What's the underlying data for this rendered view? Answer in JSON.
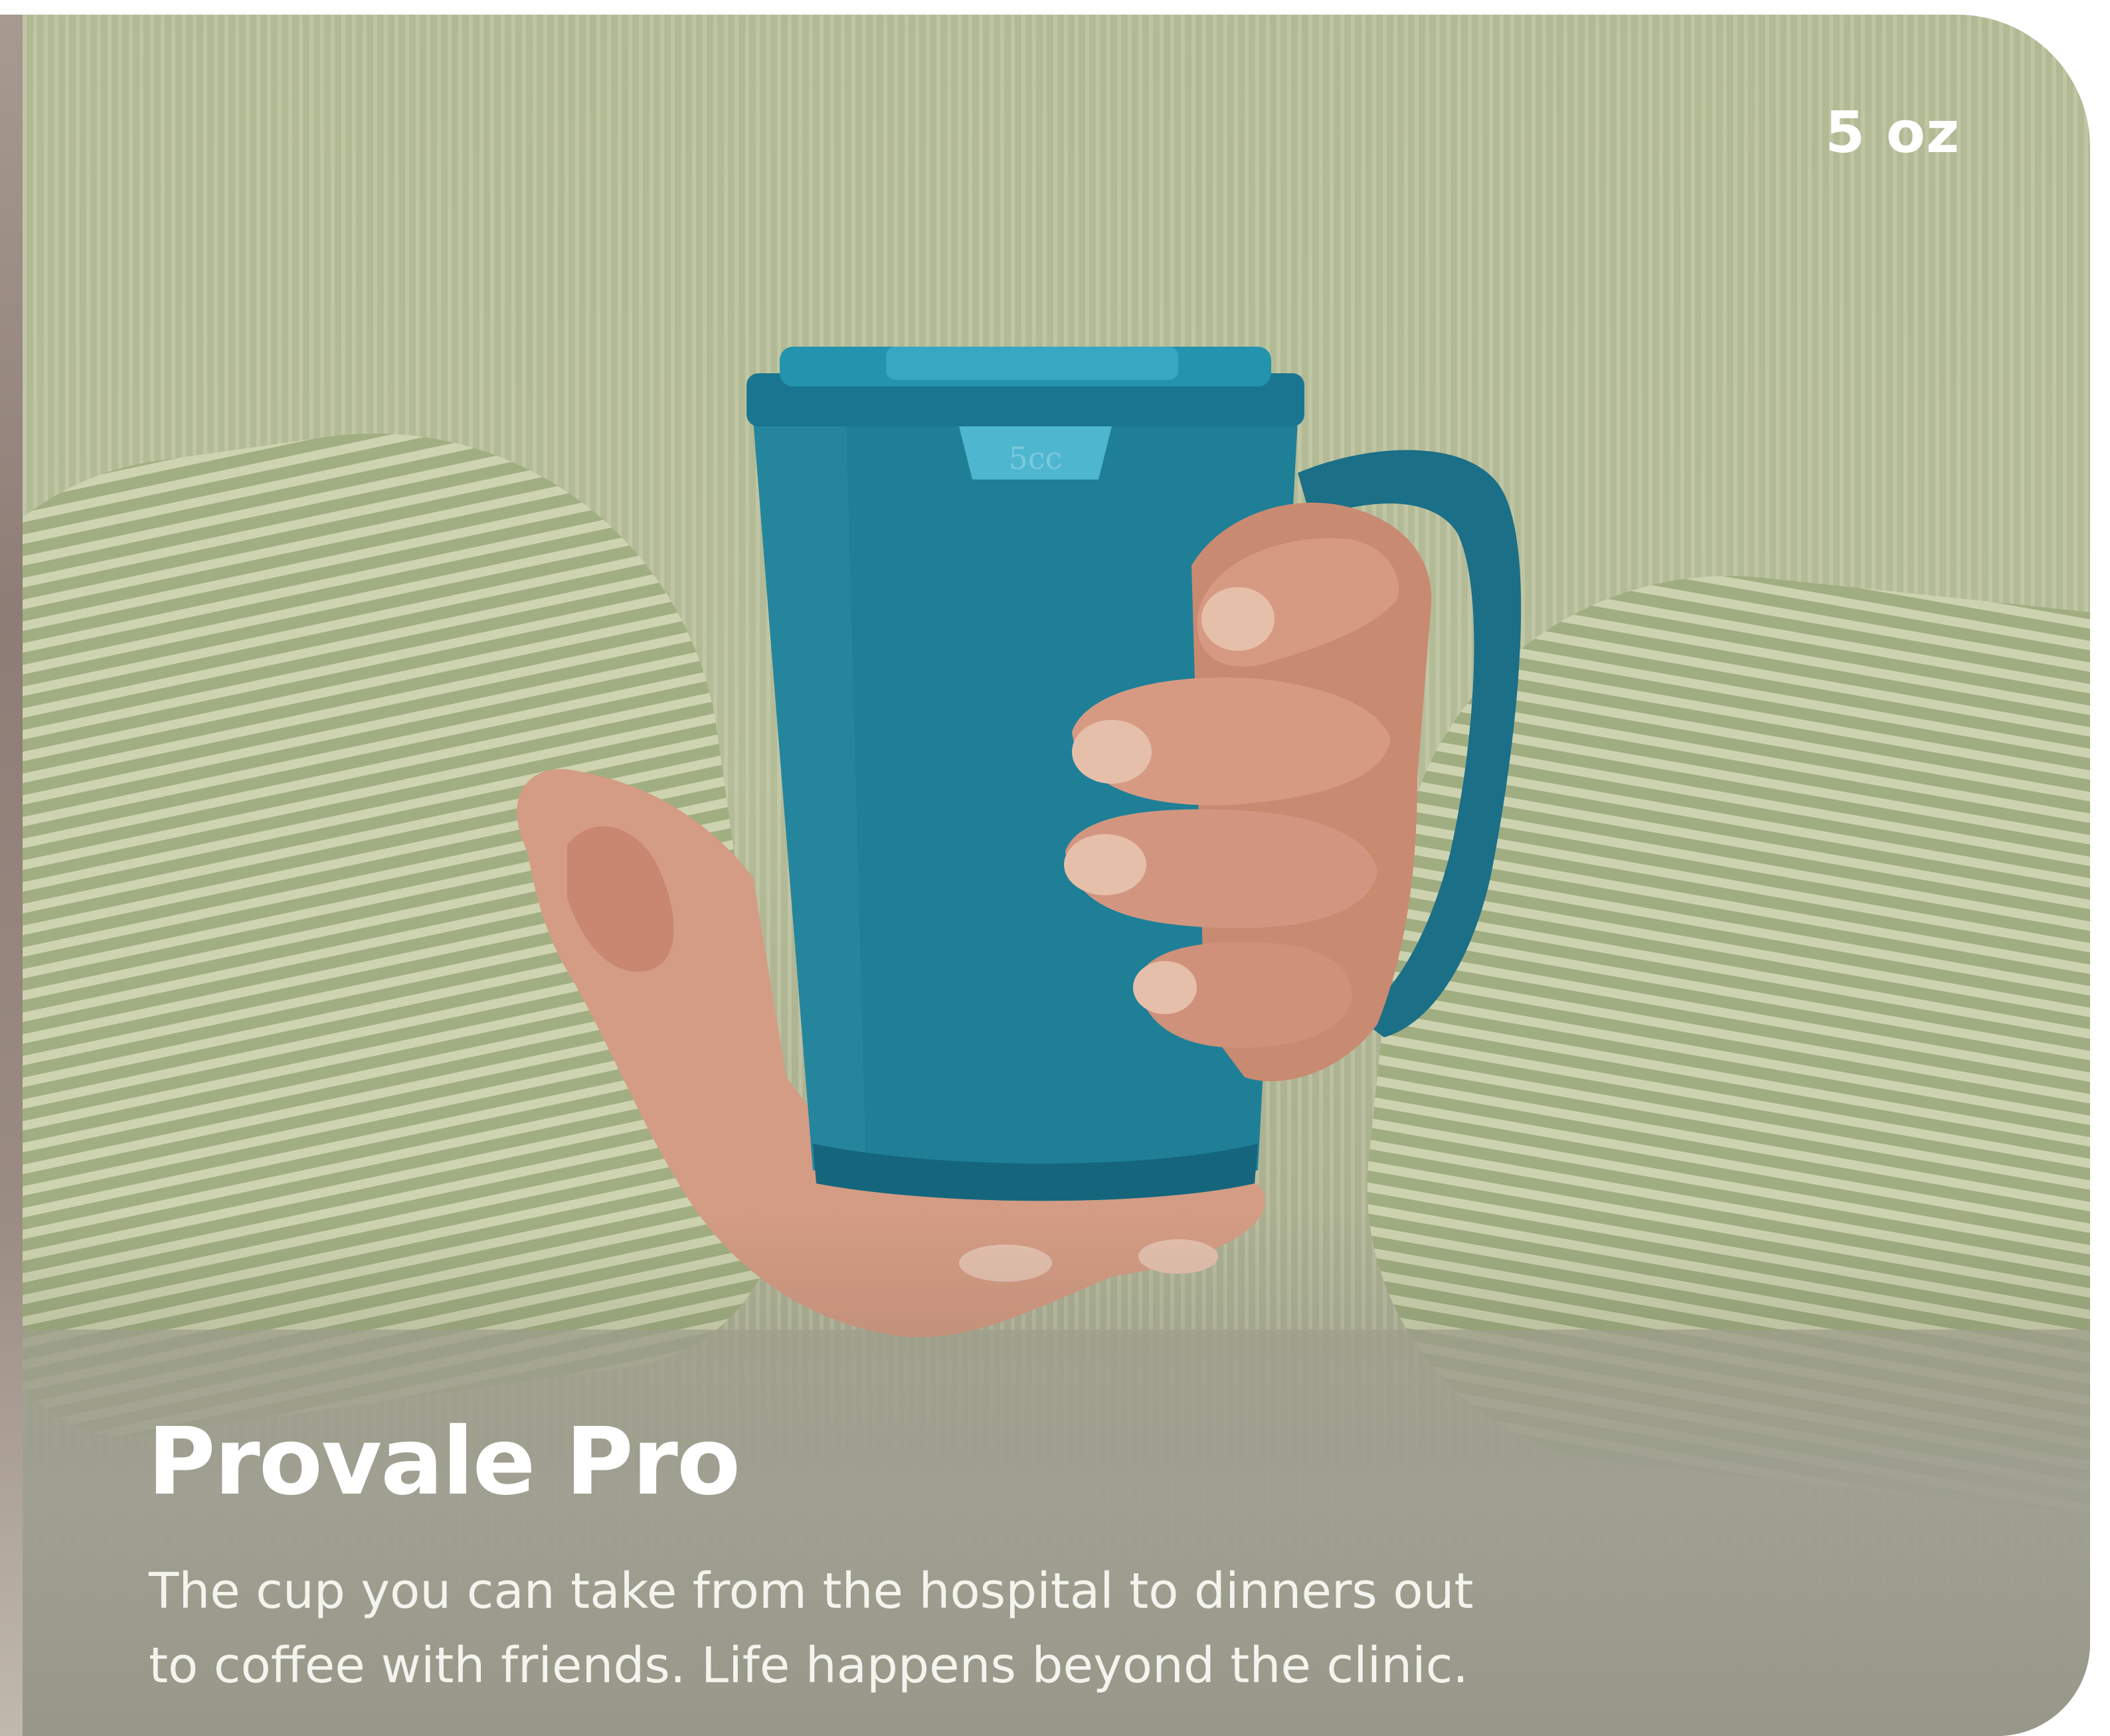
{
  "badge": {
    "size": "5 oz"
  },
  "product": {
    "name": "Provale Pro",
    "description_line1": "The cup you can take from the hospital to dinners out",
    "description_line2": "to coffee with friends. Life happens beyond the clinic."
  },
  "cup": {
    "lid_marking": "5cc",
    "color": "#1f7f97"
  },
  "colors": {
    "sweater": "#b5bd98",
    "text": "#ffffff"
  }
}
